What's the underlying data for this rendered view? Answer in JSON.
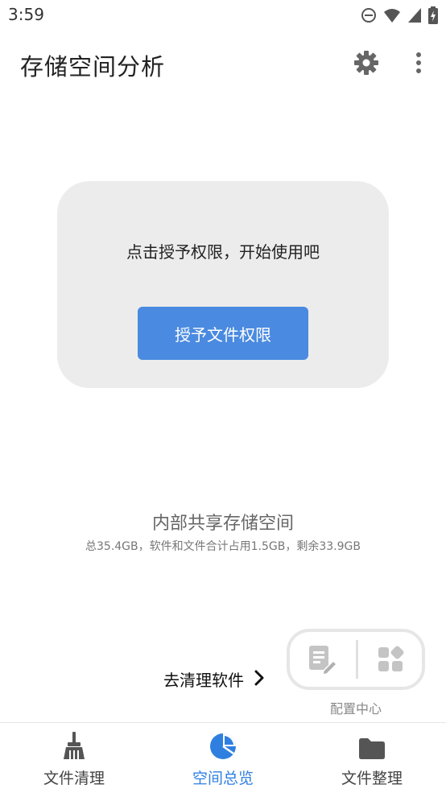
{
  "status_bar": {
    "time": "3:59",
    "icons": [
      "do-not-disturb-icon",
      "wifi-icon",
      "signal-icon",
      "battery-charging-icon"
    ]
  },
  "app_bar": {
    "title": "存储空间分析",
    "actions": [
      "settings-icon",
      "more-vert-icon"
    ]
  },
  "permission_card": {
    "message": "点击授予权限，开始使用吧",
    "button_label": "授予文件权限",
    "accent": "#4a8ae0"
  },
  "storage": {
    "title": "内部共享存储空间",
    "summary": "总35.4GB，软件和文件合计占用1.5GB，剩余33.9GB"
  },
  "clean_apps_link": {
    "label": "去清理软件",
    "icon": "chevron-right-icon"
  },
  "config_center": {
    "label": "配置中心",
    "icons": [
      "note-edit-icon",
      "apps-grid-icon"
    ]
  },
  "bottom_nav": {
    "items": [
      {
        "label": "文件清理",
        "icon": "broom-icon",
        "active": false
      },
      {
        "label": "空间总览",
        "icon": "pie-chart-icon",
        "active": true
      },
      {
        "label": "文件整理",
        "icon": "folder-icon",
        "active": false
      }
    ],
    "active_color": "#2f7fe0"
  }
}
